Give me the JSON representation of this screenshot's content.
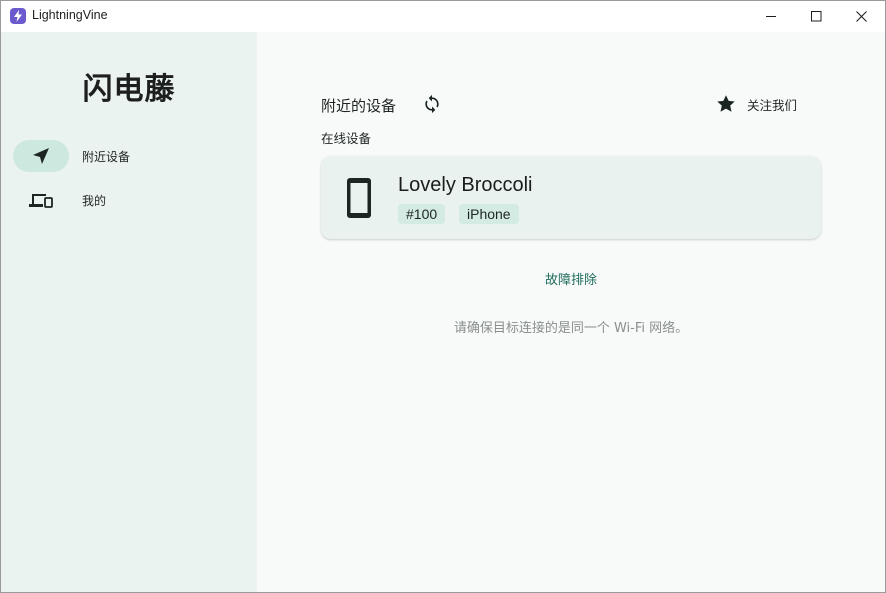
{
  "window": {
    "title": "LightningVine"
  },
  "sidebar": {
    "brand": "闪电藤",
    "items": [
      {
        "label": "附近设备",
        "icon": "send-icon",
        "active": true
      },
      {
        "label": "我的",
        "icon": "devices-icon",
        "active": false
      }
    ]
  },
  "main": {
    "section_title": "附近的设备",
    "follow_label": "关注我们",
    "online_label": "在线设备",
    "devices": [
      {
        "name": "Lovely Broccoli",
        "id": "#100",
        "type": "iPhone"
      }
    ],
    "troubleshoot_label": "故障排除",
    "hint": "请确保目标连接的是同一个 Wi-Fi 网络。"
  },
  "colors": {
    "accent": "#1d6b5b",
    "sidebar_bg": "#ebf3f0",
    "active_pill": "#cde8df",
    "card_bg": "#e9f2ef",
    "chip_bg": "#d4ebe3"
  }
}
